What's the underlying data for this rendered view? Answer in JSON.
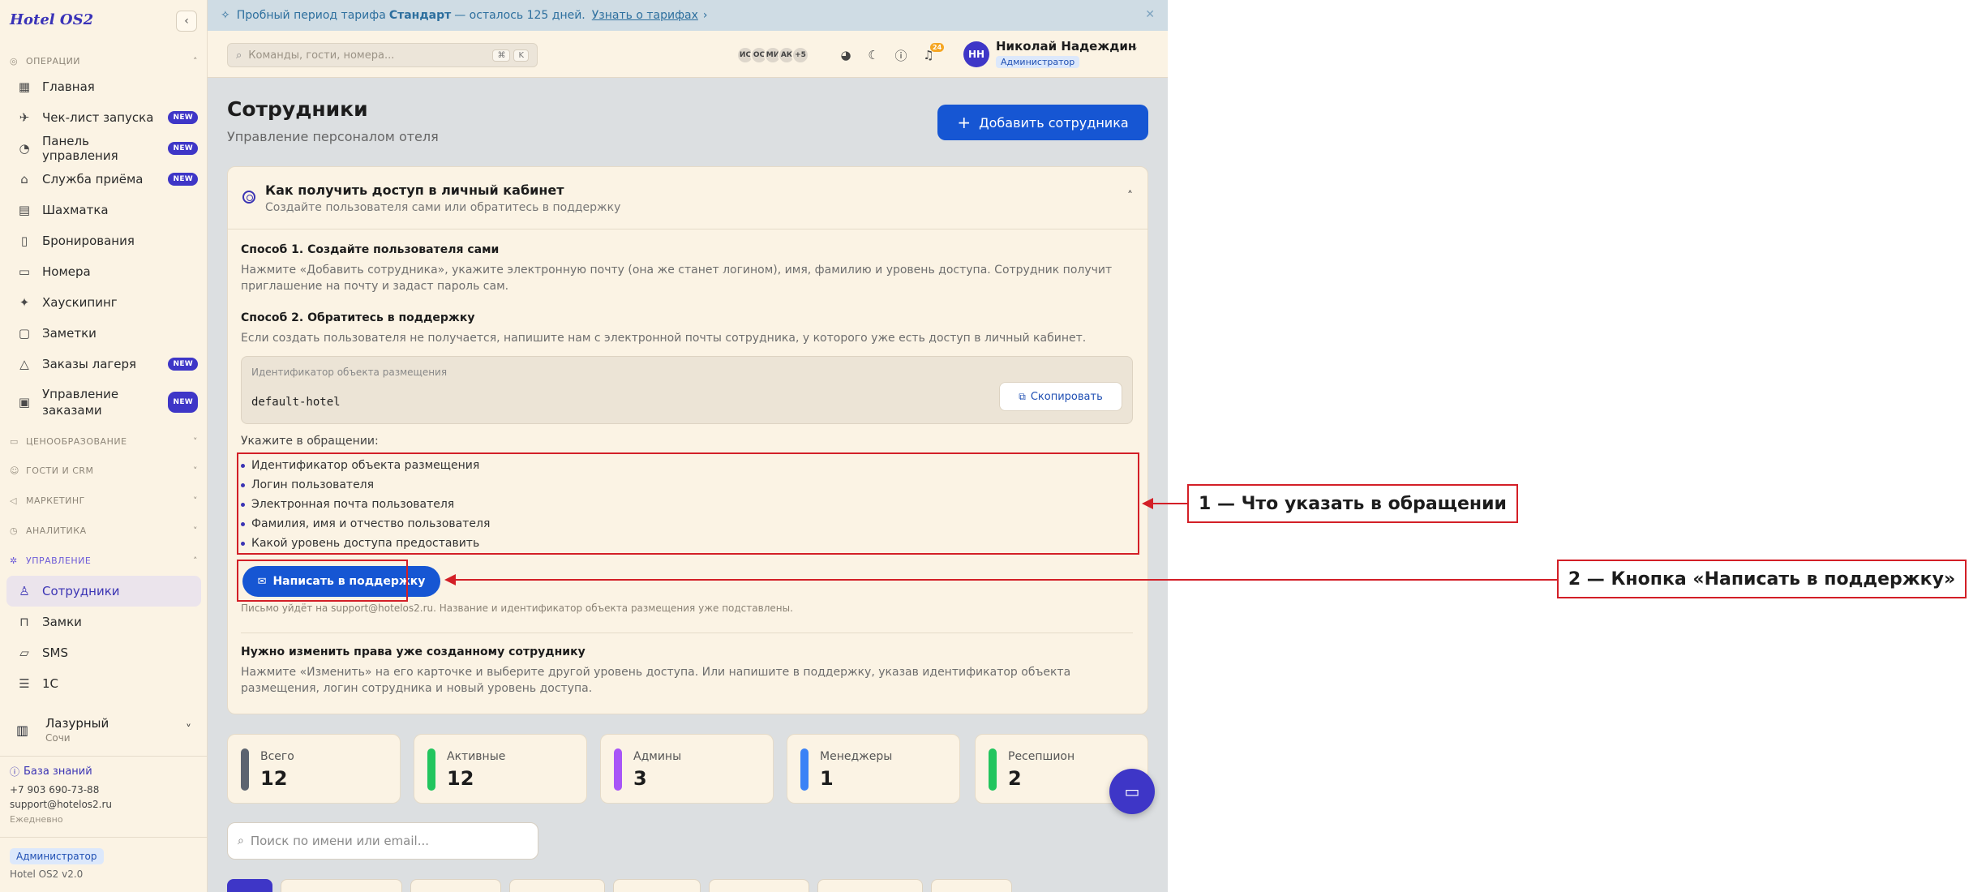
{
  "app": {
    "logo": "Hotel OS2"
  },
  "sidebar": {
    "sections": {
      "operations": "Операции",
      "pricing": "Ценообразование",
      "guests": "Гости и CRM",
      "marketing": "Маркетинг",
      "analytics": "Аналитика",
      "management": "Управление"
    },
    "items": {
      "home": "Главная",
      "checklist": "Чек-лист запуска",
      "dashboard": "Панель управления",
      "frontdesk": "Служба приёма",
      "chessboard": "Шахматка",
      "bookings": "Бронирования",
      "rooms": "Номера",
      "housekeeping": "Хаускипинг",
      "notes": "Заметки",
      "camp_orders": "Заказы лагеря",
      "order_mgmt": "Управление заказами",
      "staff": "Сотрудники",
      "locks": "Замки",
      "sms": "SMS",
      "onec": "1С"
    },
    "new_badge": "NEW",
    "hotel": {
      "name": "Лазурный",
      "city": "Сочи"
    },
    "knowledge_base": "База знаний",
    "phone": "+7 903 690-73-88",
    "email": "support@hotelos2.ru",
    "schedule": "Ежедневно",
    "role": "Администратор",
    "version": "Hotel OS2 v2.0"
  },
  "trial": {
    "prefix": "Пробный период тарифа",
    "plan": "Стандарт",
    "remaining": "— осталось 125 дней.",
    "link": "Узнать о тарифах"
  },
  "header": {
    "search_placeholder": "Команды, гости, номера...",
    "kbd1": "⌘",
    "kbd2": "K",
    "avatars": [
      "ИС",
      "ОС",
      "МИ",
      "АК"
    ],
    "more": "+5",
    "notif_count": "24",
    "user_initials": "НН",
    "user_name": "Николай Надеждин",
    "user_role": "Администратор"
  },
  "page": {
    "title": "Сотрудники",
    "subtitle": "Управление персоналом отеля",
    "add_button": "Добавить сотрудника"
  },
  "help": {
    "title": "Как получить доступ в личный кабинет",
    "subtitle": "Создайте пользователя сами или обратитесь в поддержку",
    "method1_title": "Способ 1. Создайте пользователя сами",
    "method1_text": "Нажмите «Добавить сотрудника», укажите электронную почту (она же станет логином), имя, фамилию и уровень доступа. Сотрудник получит приглашение на почту и задаст пароль сам.",
    "method2_title": "Способ 2. Обратитесь в поддержку",
    "method2_text": "Если создать пользователя не получается, напишите нам с электронной почты сотрудника, у которого уже есть доступ в личный кабинет.",
    "id_label": "Идентификатор объекта размещения",
    "id_value": "default-hotel",
    "copy_button": "Скопировать",
    "mention_label": "Укажите в обращении:",
    "mention_items": [
      "Идентификатор объекта размещения",
      "Логин пользователя",
      "Электронная почта пользователя",
      "Фамилия, имя и отчество пользователя",
      "Какой уровень доступа предоставить"
    ],
    "support_button": "Написать в поддержку",
    "support_note": "Письмо уйдёт на support@hotelos2.ru. Название и идентификатор объекта размещения уже подставлены.",
    "change_title": "Нужно изменить права уже созданному сотруднику",
    "change_text": "Нажмите «Изменить» на его карточке и выберите другой уровень доступа. Или напишите в поддержку, указав идентификатор объекта размещения, логин сотрудника и новый уровень доступа."
  },
  "stats": [
    {
      "label": "Всего",
      "value": "12",
      "color": "#5c6470"
    },
    {
      "label": "Активные",
      "value": "12",
      "color": "#22c55e"
    },
    {
      "label": "Админы",
      "value": "3",
      "color": "#a855f7"
    },
    {
      "label": "Менеджеры",
      "value": "1",
      "color": "#3b82f6"
    },
    {
      "label": "Ресепшион",
      "value": "2",
      "color": "#22c55e"
    }
  ],
  "staff_search_placeholder": "Поиск по имени или email...",
  "annotations": {
    "a1": "1 — Что указать в обращении",
    "a2": "2 — Кнопка «Написать в поддержку»"
  },
  "colors": {
    "accent": "#3e36c7",
    "primary_button": "#1656d3",
    "annotation": "#d31f27"
  }
}
